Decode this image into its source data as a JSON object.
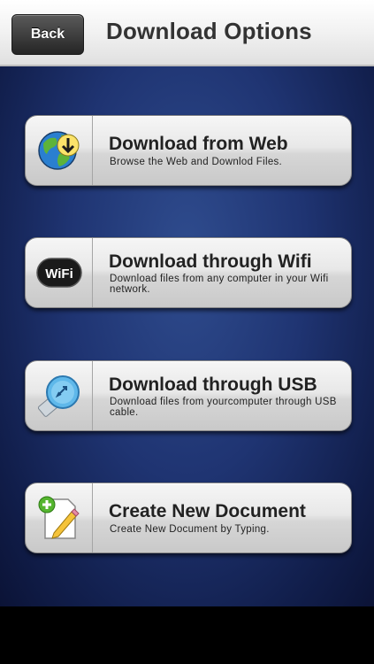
{
  "header": {
    "back_label": "Back",
    "title": "Download Options"
  },
  "options": [
    {
      "title": "Download from Web",
      "description": "Browse the Web and Downlod Files.",
      "icon": "globe-download-icon"
    },
    {
      "title": "Download through Wifi",
      "description": "Download files from any computer in your Wifi network.",
      "icon": "wifi-icon"
    },
    {
      "title": "Download through USB",
      "description": "Download files from yourcomputer through USB cable.",
      "icon": "usb-icon"
    },
    {
      "title": "Create New Document",
      "description": "Create New Document by Typing.",
      "icon": "new-document-icon"
    }
  ],
  "colors": {
    "background_blue": "#1f3472",
    "header_bg": "#f3f3f3",
    "button_dark": "#3a3a3a"
  }
}
